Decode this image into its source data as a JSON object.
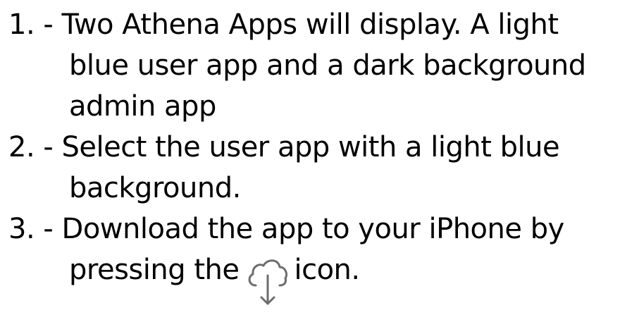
{
  "steps": [
    {
      "lines": [
        "1. - Two Athena Apps will display.  A light",
        "blue user app and a dark background",
        "admin app"
      ]
    },
    {
      "lines": [
        "2. - Select the user app with a light blue",
        "background."
      ]
    },
    {
      "lines": [
        "3. - Download the app to your iPhone by"
      ],
      "icon_line": {
        "before": "pressing the",
        "icon": "cloud-download-icon",
        "after": "icon."
      }
    }
  ],
  "colors": {
    "text": "#000000",
    "icon_stroke": "#6d6d6d",
    "background": "#ffffff"
  }
}
